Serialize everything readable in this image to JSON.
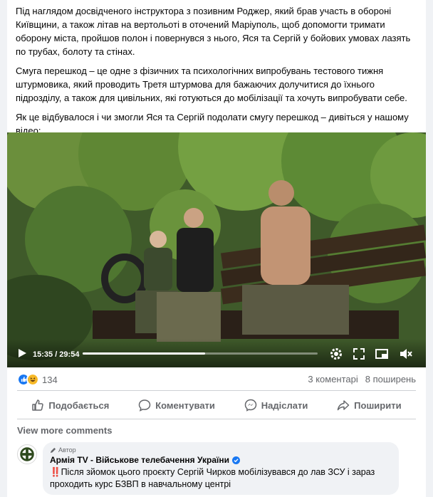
{
  "post": {
    "paragraphs": [
      "Під наглядом досвідченого інструктора з позивним Роджер, який брав участь в обороні Київщини, а також літав на вертольоті в оточений Маріуполь, щоб допомогти тримати оборону міста, пройшов полон і повернувся з нього, Яся та Сергій у бойових умовах лазять по трубах, болоту та стінах.",
      "Смуга перешкод – це одне з фізичних та психологічних випробувань тестового тижня штурмовика, який проводить Третя штурмова для бажаючих долучитися до їхнього підрозділу, а також для цивільних, які готуються до мобілізації та хочуть випробувати себе.",
      "Як це відбувалося і чи змогли Яся та Сергій подолати смугу перешкод – дивіться у нашому відео:"
    ]
  },
  "video": {
    "time": "15:35 / 29:54",
    "progress": 0.52,
    "icons": [
      "play-icon",
      "settings-icon",
      "fullscreen-icon",
      "picture-in-picture-icon",
      "volume-icon"
    ]
  },
  "reactions": {
    "count": "134",
    "icons": [
      "like-icon",
      "haha-icon"
    ],
    "comments": "3 коментарі",
    "shares": "8 поширень"
  },
  "actions": {
    "like": "Подобається",
    "comment": "Коментувати",
    "send": "Надіслати",
    "share": "Поширити"
  },
  "comments": {
    "view_more": "View more comments",
    "items": [
      {
        "badge": "Автор",
        "author": "Армія TV - Військове телебачення України",
        "text": "‼️Після зйомок цього проєкту Сергій Чирков мобілізувався до лав ЗСУ і зараз проходить курс БЗВП в навчальному центрі"
      }
    ]
  },
  "colors": {
    "accent": "#1877f2",
    "secondary_text": "#65676b",
    "background": "#f0f2f5"
  }
}
